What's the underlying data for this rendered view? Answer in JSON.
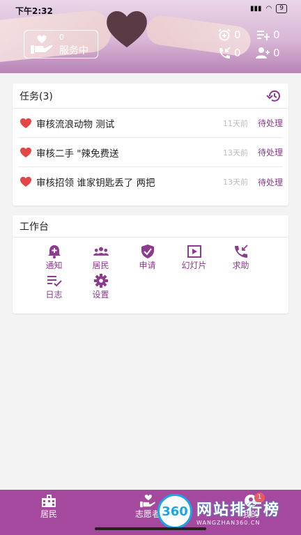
{
  "status_bar": {
    "time": "下午2:32",
    "battery": "9"
  },
  "header": {
    "service": {
      "count": "0",
      "label": "服务中"
    },
    "stats": [
      {
        "icon": "alarm-add-icon",
        "value": "0"
      },
      {
        "icon": "playlist-add-icon",
        "value": "0"
      },
      {
        "icon": "phone-callback-icon",
        "value": "0"
      },
      {
        "icon": "person-add-icon",
        "value": "0"
      }
    ]
  },
  "tasks": {
    "title": "任务(3)",
    "items": [
      {
        "text": "审核流浪动物 测试",
        "time": "11天前",
        "status": "待处理"
      },
      {
        "text": "审核二手 \"辣免费送",
        "time": "13天前",
        "status": "待处理"
      },
      {
        "text": "审核招领 谁家钥匙丢了 两把",
        "time": "13天前",
        "status": "待处理"
      }
    ]
  },
  "workbench": {
    "title": "工作台",
    "tools": [
      {
        "label": "通知",
        "icon": "bell-plus-icon"
      },
      {
        "label": "居民",
        "icon": "people-icon"
      },
      {
        "label": "申请",
        "icon": "shield-check-icon"
      },
      {
        "label": "幻灯片",
        "icon": "slideshow-icon"
      },
      {
        "label": "求助",
        "icon": "phone-callback-icon"
      },
      {
        "label": "日志",
        "icon": "checklist-icon"
      },
      {
        "label": "设置",
        "icon": "gear-icon"
      }
    ]
  },
  "bottom_nav": {
    "items": [
      {
        "label": "居民",
        "icon": "building-icon"
      },
      {
        "label": "志愿者",
        "icon": "volunteer-icon"
      },
      {
        "label": "我的",
        "icon": "person-icon",
        "badge": "1"
      }
    ]
  },
  "watermark": {
    "logo": "360",
    "title": "网站排行榜",
    "subtitle": "WANGZHAN360.CN"
  },
  "colors": {
    "accent": "#8e3a8f",
    "bottom_bar": "#a5499f",
    "heart": "#e64545"
  }
}
